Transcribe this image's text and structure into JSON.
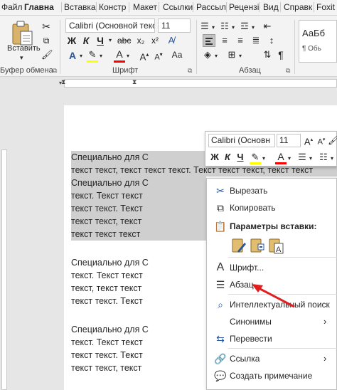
{
  "tabs": [
    "Файл",
    "Главна",
    "Вставка",
    "Констр",
    "Макет",
    "Ссылки",
    "Рассыл",
    "Рецензі",
    "Вид",
    "Справк",
    "Foxit"
  ],
  "ribbon": {
    "clipboard": {
      "paste_label": "Вставить",
      "group_label": "Буфер обмена"
    },
    "font": {
      "font_name": "Calibri (Основной текст",
      "font_size": "11",
      "bold": "Ж",
      "italic": "К",
      "underline": "Ч",
      "subscript": "x₂",
      "superscript": "x²",
      "group_label": "Шрифт"
    },
    "paragraph": {
      "group_label": "Абзац",
      "pilcrow": "¶"
    },
    "styles": {
      "preview_main": "АаБб",
      "preview_sub": "¶ Обь"
    }
  },
  "document": {
    "lines": [
      "Специально для С",
      "текст текст, текст текст текст. Текст текст текст, текст текст",
      "Специально для С",
      "текст. Текст текст",
      "текст текст. Текст",
      "текст текст, текст",
      "текст текст текст",
      "Специально для С",
      "текст. Текст текст",
      "текст, текст текст",
      "текст текст. Текст",
      "Специально для С",
      "текст. Текст текст",
      "текст текст. Текст",
      "текст текст, текст"
    ]
  },
  "mini_toolbar": {
    "font_name": "Calibri (Основн",
    "font_size": "11",
    "bold": "Ж",
    "italic": "К",
    "underline": "Ч"
  },
  "context_menu": {
    "cut": "Вырезать",
    "copy": "Копировать",
    "paste_options": "Параметры вставки:",
    "font": "Шрифт...",
    "paragraph": "Абзац...",
    "smart_lookup": "Интеллектуальный поиск",
    "synonyms": "Синонимы",
    "translate": "Перевести",
    "link": "Ссылка",
    "new_comment": "Создать примечание"
  },
  "colors": {
    "accent": "#2b579a",
    "highlight": "#ffff00",
    "font_color": "#ff0000",
    "arrow": "#e02020"
  }
}
